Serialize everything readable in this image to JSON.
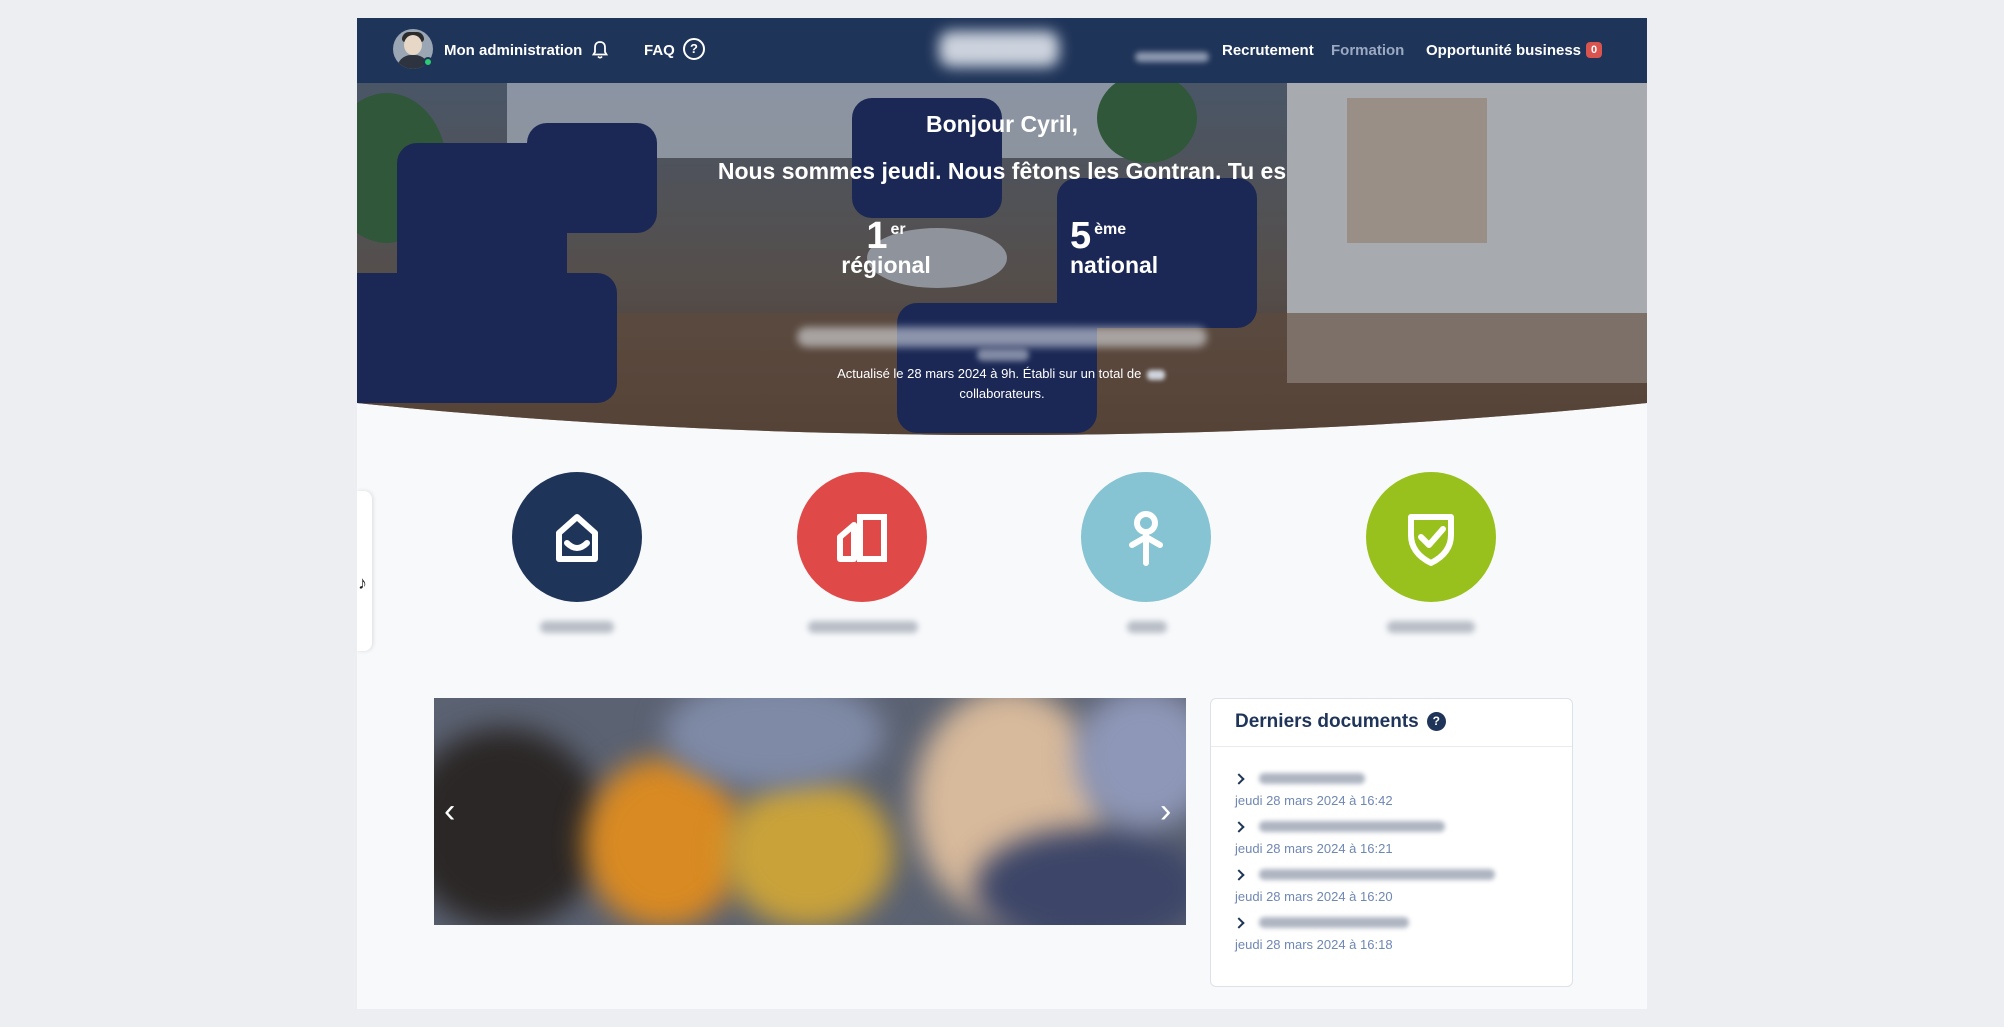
{
  "nav": {
    "admin_label": "Mon administration",
    "faq_label": "FAQ",
    "help_glyph": "?",
    "recrutement": "Recrutement",
    "formation": "Formation",
    "opportunite": "Opportunité business",
    "opportunite_count": "0",
    "colors": {
      "bg": "#1f3459",
      "inactive_link": "#9ba9c2",
      "badge": "#d9534f",
      "online": "#2ecc71"
    }
  },
  "hero": {
    "greeting": "Bonjour Cyril,",
    "fete": "Nous sommes jeudi. Nous fêtons les Gontran. Tu es",
    "rank_regional": {
      "number": "1",
      "suffix": "er",
      "label": "régional"
    },
    "rank_national": {
      "number": "5",
      "suffix": "ème",
      "label": "national"
    },
    "updated_prefix": "Actualisé le 28 mars 2024 à 9h. Établi sur un total de",
    "updated_suffix": "collaborateurs."
  },
  "sidetab": {
    "icon": "music-note-icon",
    "glyph": "♪"
  },
  "shortcuts": [
    {
      "icon": "home-smile-icon",
      "color": "#1f3459"
    },
    {
      "icon": "building-icon",
      "color": "#df4a49"
    },
    {
      "icon": "key-person-icon",
      "color": "#86c3d3"
    },
    {
      "icon": "shield-check-icon",
      "color": "#99c11d"
    }
  ],
  "carousel": {
    "prev_glyph": "‹",
    "next_glyph": "›"
  },
  "docs": {
    "title": "Derniers documents",
    "help_glyph": "?",
    "items": [
      {
        "date": "jeudi 28 mars 2024 à 16:42"
      },
      {
        "date": "jeudi 28 mars 2024 à 16:21"
      },
      {
        "date": "jeudi 28 mars 2024 à 16:20"
      },
      {
        "date": "jeudi 28 mars 2024 à 16:18"
      }
    ]
  }
}
